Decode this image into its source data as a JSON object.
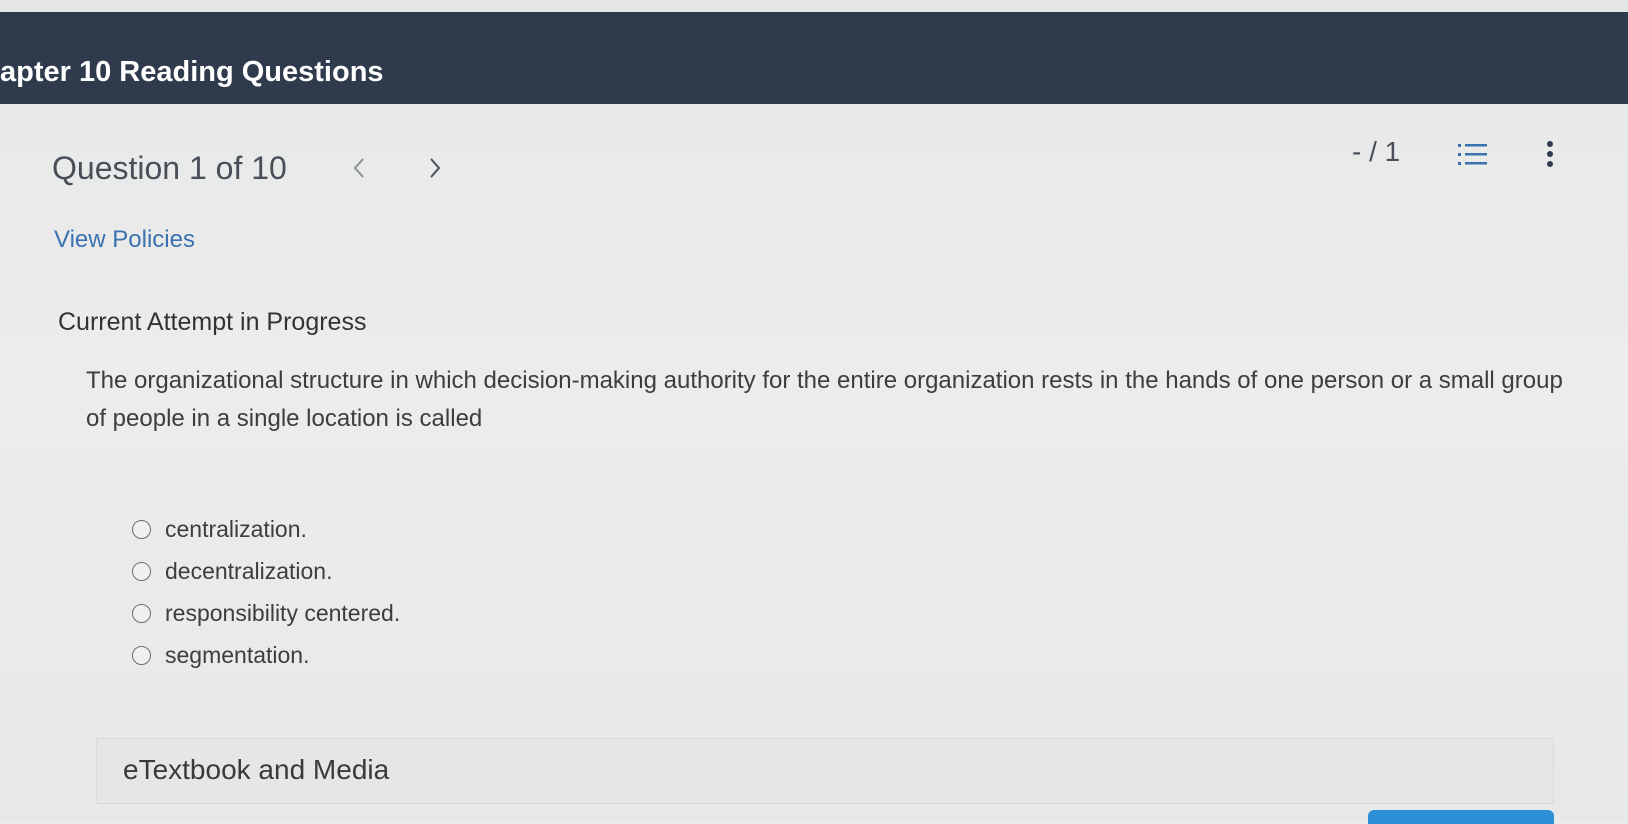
{
  "header": {
    "title": "apter 10 Reading Questions"
  },
  "question_nav": {
    "counter": "Question 1 of 10",
    "prev_icon": "chevron-left-icon",
    "next_icon": "chevron-right-icon"
  },
  "score": "- / 1",
  "toolbar": {
    "list_icon": "numbered-list-icon",
    "more_icon": "kebab-menu-icon"
  },
  "policies_link": "View Policies",
  "attempt_heading": "Current Attempt in Progress",
  "question": {
    "text": "The organizational structure in which decision-making authority for the entire organization rests in the hands of one person or a small group of people in a single location is called",
    "options": [
      "centralization.",
      "decentralization.",
      "responsibility centered.",
      "segmentation."
    ]
  },
  "media": {
    "label": "eTextbook and Media"
  },
  "colors": {
    "header_bg": "#2f3a4c",
    "link": "#3a72b0",
    "accent_button": "#2d8fd6"
  }
}
